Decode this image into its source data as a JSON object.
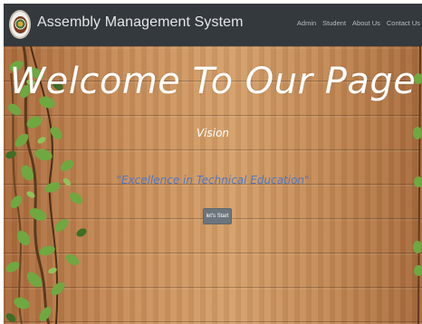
{
  "navbar": {
    "brand": "Assembly Management System",
    "links": [
      "Admin",
      "Student",
      "About Us",
      "Contact Us"
    ]
  },
  "hero": {
    "title": "Welcome To Our Page",
    "subtitle": "Vision",
    "motto": "\"Excellence in Technical Education\"",
    "button_label": "let's Start"
  },
  "colors": {
    "navbar_bg": "#34393e",
    "motto_text": "#4f78c6",
    "button_bg": "#6c757d",
    "wood": "#c98f5b",
    "leaf": "#6fa840"
  },
  "icons": {
    "logo": "college-emblem-logo"
  }
}
